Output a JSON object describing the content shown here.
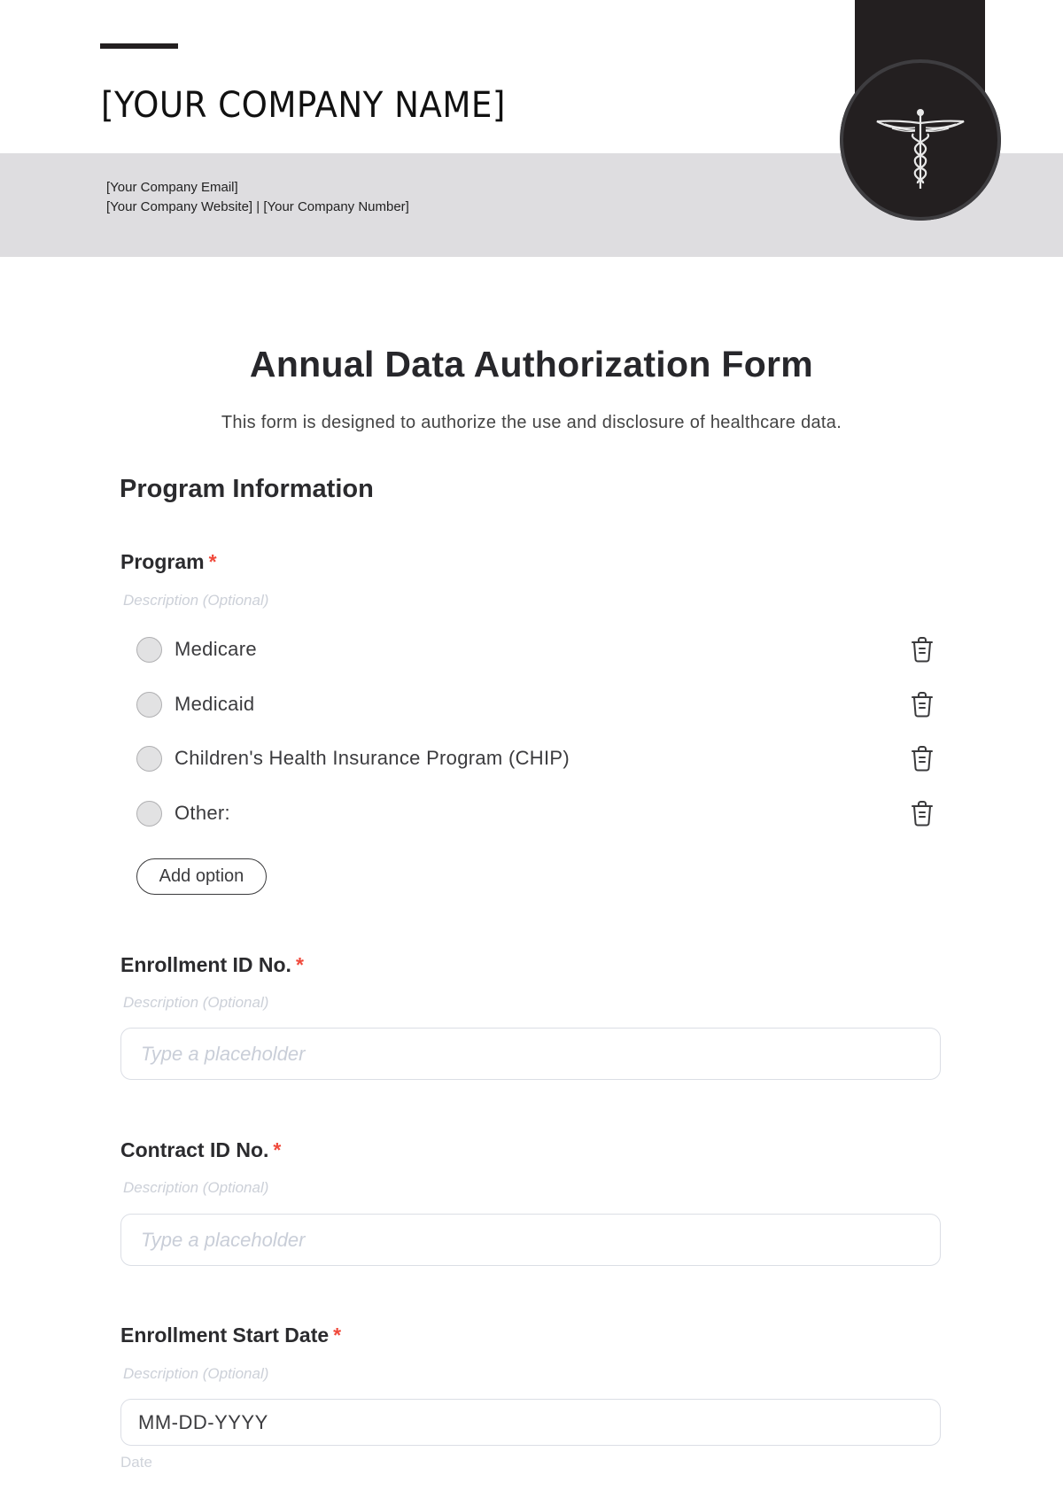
{
  "header": {
    "company_name": "[YOUR COMPANY NAME]",
    "email": "[Your Company Email]",
    "website_number": "[Your Company Website] | [Your Company Number]",
    "logo_icon": "caduceus-icon"
  },
  "form": {
    "title": "Annual Data Authorization Form",
    "subtitle": "This form is designed to authorize the use and disclosure of healthcare data.",
    "section_title": "Program Information",
    "required_mark": "*",
    "fields": [
      {
        "label": "Program",
        "required": true,
        "description": "Description (Optional)",
        "type": "radio",
        "options": [
          {
            "label": "Medicare",
            "selected": false
          },
          {
            "label": "Medicaid",
            "selected": false
          },
          {
            "label": "Children's Health Insurance Program (CHIP)",
            "selected": false
          },
          {
            "label": "Other:",
            "selected": false
          }
        ],
        "add_option_label": "Add option"
      },
      {
        "label": "Enrollment ID No.",
        "required": true,
        "description": "Description (Optional)",
        "type": "text",
        "value": "",
        "placeholder": "Type a placeholder"
      },
      {
        "label": "Contract ID No.",
        "required": true,
        "description": "Description (Optional)",
        "type": "text",
        "value": "",
        "placeholder": "Type a placeholder"
      },
      {
        "label": "Enrollment Start Date",
        "required": true,
        "description": "Description (Optional)",
        "type": "date",
        "value": "MM-DD-YYYY",
        "hint": "Date"
      }
    ]
  }
}
